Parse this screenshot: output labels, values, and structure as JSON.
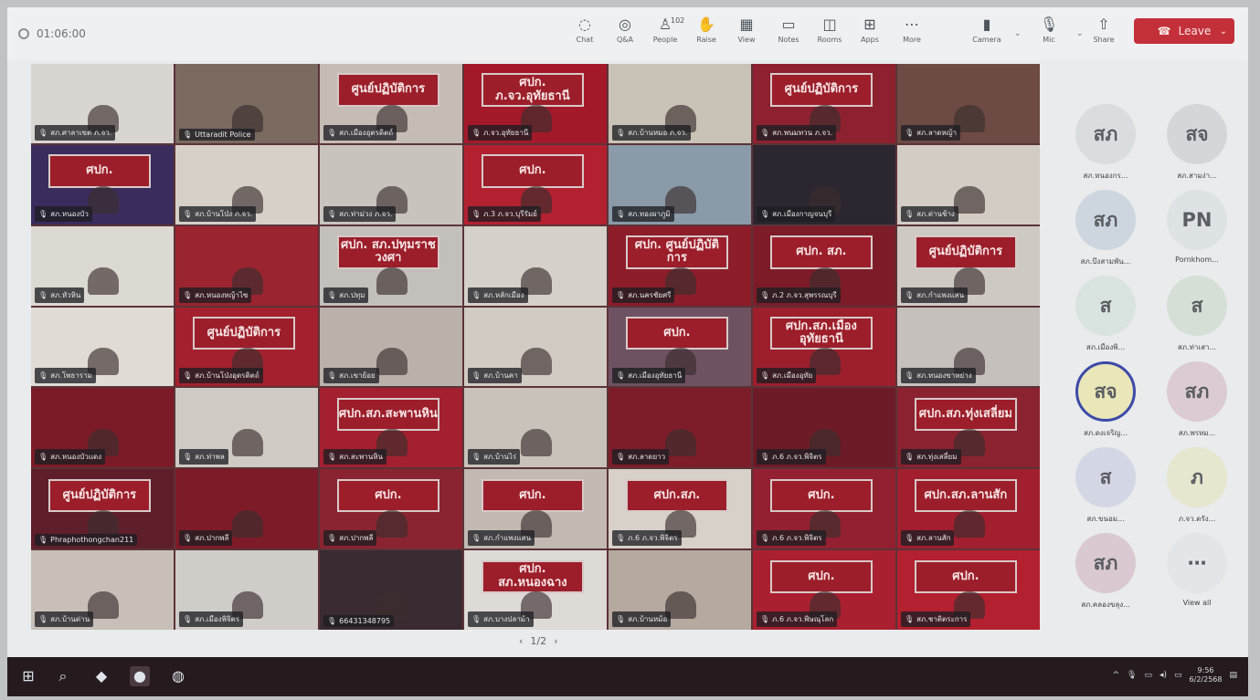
{
  "toolbar": {
    "timer": "01:06:00",
    "buttons": [
      {
        "label": "Chat",
        "icon": "chat-icon",
        "glyph": "◌"
      },
      {
        "label": "Q&A",
        "icon": "qa-icon",
        "glyph": "◎"
      },
      {
        "label": "People",
        "icon": "people-icon",
        "glyph": "♙",
        "count": "102"
      },
      {
        "label": "Raise",
        "icon": "raise-hand-icon",
        "glyph": "✋"
      },
      {
        "label": "View",
        "icon": "view-icon",
        "glyph": "▦"
      },
      {
        "label": "Notes",
        "icon": "notes-icon",
        "glyph": "▭"
      },
      {
        "label": "Rooms",
        "icon": "rooms-icon",
        "glyph": "◫"
      },
      {
        "label": "Apps",
        "icon": "apps-icon",
        "glyph": "⊞"
      },
      {
        "label": "More",
        "icon": "more-icon",
        "glyph": "⋯"
      },
      {
        "label": "Camera",
        "icon": "camera-icon",
        "glyph": "▮"
      },
      {
        "label": "Mic",
        "icon": "mic-icon",
        "glyph": "🎙"
      },
      {
        "label": "Share",
        "icon": "share-icon",
        "glyph": "⇧"
      }
    ],
    "leave_label": "Leave"
  },
  "tiles": [
    {
      "banner": "",
      "name": "สภ.ศาลาเขต ภ.จว.",
      "bg": "#d9d6d2"
    },
    {
      "banner": "",
      "name": "Uttaradit Police",
      "bg": "#7a6a60"
    },
    {
      "banner": "ศูนย์ปฏิบัติการ",
      "name": "สภ.เมืองอุตรดิตถ์",
      "bg": "#c5bcb6"
    },
    {
      "banner": "ศปก. ภ.จว.อุทัยธานี",
      "name": "ภ.จว.อุทัยธานี",
      "bg": "#a4192a"
    },
    {
      "banner": "",
      "name": "สภ.บ้านหมอ ภ.จว.",
      "bg": "#c9c2b6"
    },
    {
      "banner": "ศูนย์ปฏิบัติการ",
      "name": "สภ.พนมทวน ภ.จว.",
      "bg": "#8d2130"
    },
    {
      "banner": "",
      "name": "สภ.ลาดหญ้า",
      "bg": "#6e4a44"
    },
    {
      "banner": "ศปก.",
      "name": "สภ.หนองบัว",
      "bg": "#3a2c5c"
    },
    {
      "banner": "",
      "name": "สภ.บ้านโป่ง ภ.จว.",
      "bg": "#d6d0c8"
    },
    {
      "banner": "",
      "name": "สภ.ท่าม่วง ภ.จว.",
      "bg": "#c8c3bd"
    },
    {
      "banner": "ศปก.",
      "name": "ภ.3 ภ.จว.บุรีรัมย์",
      "bg": "#b32131"
    },
    {
      "banner": "",
      "name": "สภ.ทองผาภูมิ",
      "bg": "#8a9aa8"
    },
    {
      "banner": "",
      "name": "สภ.เมืองกาญจนบุรี",
      "bg": "#2c2630"
    },
    {
      "banner": "",
      "name": "สภ.ด่านช้าง",
      "bg": "#d2ccc4"
    },
    {
      "banner": "",
      "name": "สภ.หัวหิน",
      "bg": "#dcd8d2"
    },
    {
      "banner": "",
      "name": "สภ.หนองหญ้าไซ",
      "bg": "#9a2430"
    },
    {
      "banner": "ศปก. สภ.ปทุมราชวงศา",
      "name": "สภ.ปทุม",
      "bg": "#c3bfbb"
    },
    {
      "banner": "",
      "name": "สภ.หลักเมือง",
      "bg": "#d5d0c9"
    },
    {
      "banner": "ศปก. ศูนย์ปฏิบัติการ",
      "name": "สภ.นครชัยศรี",
      "bg": "#8e1d2a"
    },
    {
      "banner": "ศปก. สภ.",
      "name": "ภ.2 ภ.จว.สุพรรณบุรี",
      "bg": "#7d1c28"
    },
    {
      "banner": "ศูนย์ปฏิบัติการ",
      "name": "สภ.กำแพงแสน",
      "bg": "#cfc9c3"
    },
    {
      "banner": "",
      "name": "สภ.โพธาราม",
      "bg": "#e0dbd5"
    },
    {
      "banner": "ศูนย์ปฏิบัติการ",
      "name": "สภ.บ้านโป่งอุตรดิตถ์",
      "bg": "#a3212f"
    },
    {
      "banner": "",
      "name": "สภ.เขาย้อย",
      "bg": "#b9b1aa"
    },
    {
      "banner": "",
      "name": "สภ.บ้านคา",
      "bg": "#d2cbc3"
    },
    {
      "banner": "ศปก.",
      "name": "สภ.เมืองอุทัยธานี",
      "bg": "#6f5262"
    },
    {
      "banner": "ศปก.สภ.เมืองอุทัยธานี",
      "name": "สภ.เมืองอุทัย",
      "bg": "#9d1f2c"
    },
    {
      "banner": "",
      "name": "สภ.หนองขาหย่าง",
      "bg": "#c5c0bc"
    },
    {
      "banner": "",
      "name": "สภ.หนองบัวแดง",
      "bg": "#7b1b27"
    },
    {
      "banner": "",
      "name": "สภ.ท่าพล",
      "bg": "#cfcac4"
    },
    {
      "banner": "ศปก.สภ.สะพานหิน",
      "name": "สภ.สะพานหิน",
      "bg": "#a32030"
    },
    {
      "banner": "",
      "name": "สภ.บ้านไร่",
      "bg": "#c8c2ba"
    },
    {
      "banner": "",
      "name": "สภ.ลาดยาว",
      "bg": "#7c1d29"
    },
    {
      "banner": "",
      "name": "ภ.6 ภ.จว.พิจิตร",
      "bg": "#6d1b27"
    },
    {
      "banner": "ศปก.สภ.ทุ่งเสลี่ยม",
      "name": "สภ.ทุ่งเสลี่ยม",
      "bg": "#8b2230"
    },
    {
      "banner": "ศูนย์ปฏิบัติการ",
      "name": "Phraphothongchan211",
      "bg": "#5e1f2b"
    },
    {
      "banner": "",
      "name": "สภ.ปากพลี",
      "bg": "#7e1b28"
    },
    {
      "banner": "ศปก.",
      "name": "สภ.ปากพลี",
      "bg": "#8a2431"
    },
    {
      "banner": "ศปก.",
      "name": "สภ.กำแพงแสน",
      "bg": "#c2bab2"
    },
    {
      "banner": "ศปก.สภ.",
      "name": "ภ.6 ภ.จว.พิจิตร",
      "bg": "#d8d1c9"
    },
    {
      "banner": "ศปก.",
      "name": "ภ.6 ภ.จว.พิจิตร",
      "bg": "#922030"
    },
    {
      "banner": "ศปก.สภ.ลานสัก",
      "name": "สภ.ลานสัก",
      "bg": "#a11f2e"
    },
    {
      "banner": "",
      "name": "สภ.บ้านด่าน",
      "bg": "#c8c0b8"
    },
    {
      "banner": "",
      "name": "สภ.เมืองพิจิตร",
      "bg": "#d0ccc8"
    },
    {
      "banner": "",
      "name": "66431348795",
      "bg": "#3a2a32"
    },
    {
      "banner": "ศปก. สภ.หนองฉาง",
      "name": "สภ.บางปลาม้า",
      "bg": "#dedad6"
    },
    {
      "banner": "",
      "name": "สภ.บ้านหม้อ",
      "bg": "#b5a9a0"
    },
    {
      "banner": "ศปก.",
      "name": "ภ.6 ภ.จว.พิษณุโลก",
      "bg": "#ab2030"
    },
    {
      "banner": "ศปก.",
      "name": "สภ.ชาติตระการ",
      "bg": "#b3202f"
    }
  ],
  "pager": {
    "text": "1/2"
  },
  "side_panel": {
    "participants": [
      {
        "initials": "สภ",
        "name": "สภ.หนองกร..."
      },
      {
        "initials": "สจ",
        "name": "สภ.สามง่า..."
      },
      {
        "initials": "สภ",
        "name": "สภ.บึงสามพัน..."
      },
      {
        "initials": "PN",
        "name": "Pornkhom..."
      },
      {
        "initials": "ส",
        "name": "สภ.เมืองพิ..."
      },
      {
        "initials": "ส",
        "name": "สภ.ท่าเสา..."
      },
      {
        "initials": "สจ",
        "name": "สภ.ดงเจริญ..."
      },
      {
        "initials": "สภ",
        "name": "สภ.พรหม..."
      },
      {
        "initials": "ส",
        "name": "สภ.ขนอม..."
      },
      {
        "initials": "ภ",
        "name": "ภ.จว.ตรัง..."
      },
      {
        "initials": "สภ",
        "name": "สภ.คลองขลุง..."
      },
      {
        "initials": "⋯",
        "name": "View all"
      }
    ],
    "colors": [
      "#d9dde0",
      "#d4d7da",
      "#cdd6df",
      "#dde2e4",
      "#d9e3df",
      "#d5dfd6",
      "#e9e6b8",
      "#dccbd3",
      "#d3d7e5",
      "#e7e6ce",
      "#dac9d2",
      "#e3e6e8"
    ]
  },
  "taskbar": {
    "time": "9:56",
    "date": "6/2/2568"
  }
}
